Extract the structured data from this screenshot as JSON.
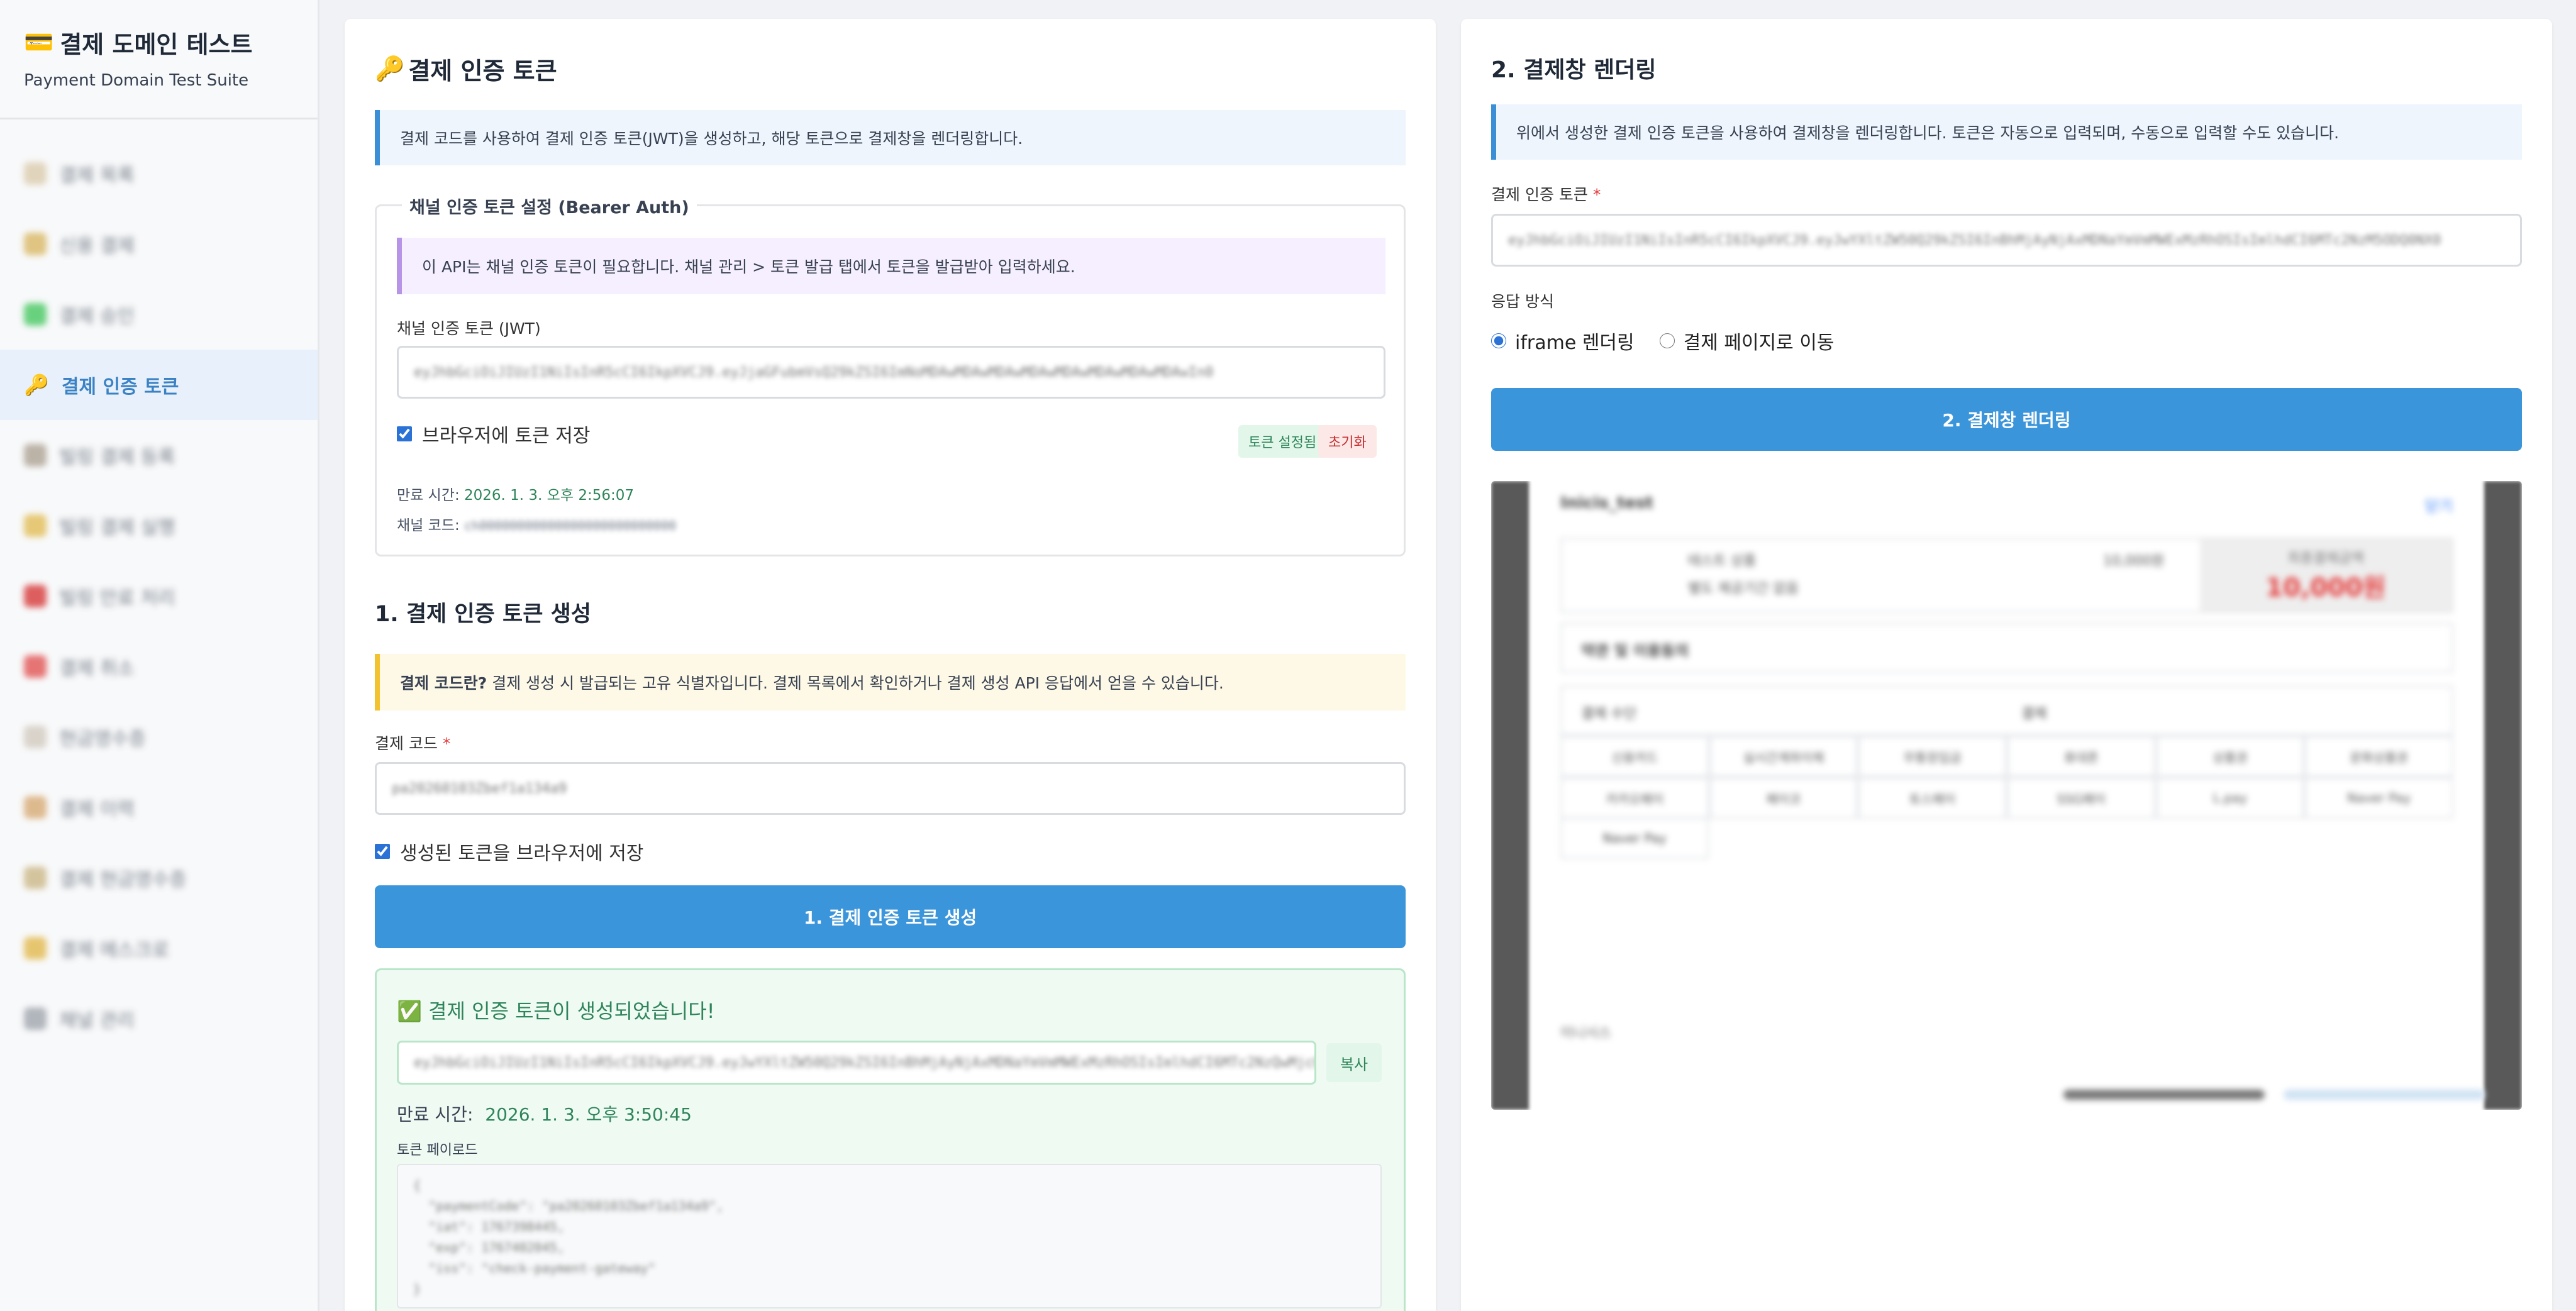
{
  "brand": {
    "icon": "💳",
    "title": "결제 도메인 테스트",
    "subtitle": "Payment Domain Test Suite"
  },
  "nav": [
    {
      "label": "결제 목록",
      "icon": "clipboard-icon",
      "color": "#d9c8a8",
      "active": false
    },
    {
      "label": "신용 결제",
      "icon": "card-icon",
      "color": "#d7b35a",
      "active": false
    },
    {
      "label": "결제 승인",
      "icon": "check-icon",
      "color": "#39c455",
      "active": false
    },
    {
      "label": "결제 인증 토큰",
      "icon": "key-icon",
      "glyph": "🔑",
      "color": "#e0a526",
      "active": true
    },
    {
      "label": "빌링 결제 등록",
      "icon": "link-icon",
      "color": "#a89c8c",
      "active": false
    },
    {
      "label": "빌링 결제 실행",
      "icon": "money-bag-icon",
      "color": "#e0b84a",
      "active": false
    },
    {
      "label": "빌링 만료 처리",
      "icon": "stop-icon",
      "color": "#d42b2b",
      "active": false
    },
    {
      "label": "결제 취소",
      "icon": "x-icon",
      "color": "#e04848",
      "active": false
    },
    {
      "label": "현금영수증",
      "icon": "receipt-icon",
      "color": "#cfc7bb",
      "active": false
    },
    {
      "label": "결제 이력",
      "icon": "calendar-icon",
      "color": "#d5a46b",
      "active": false
    },
    {
      "label": "결제 현금영수증",
      "icon": "money-icon",
      "color": "#c8b380",
      "active": false
    },
    {
      "label": "결제 에스크로",
      "icon": "lock-icon",
      "color": "#e1b441",
      "active": false
    },
    {
      "label": "채널 관리",
      "icon": "wrench-icon",
      "color": "#9aa0a8",
      "active": false
    }
  ],
  "left": {
    "title_icon": "🔑",
    "title": "결제 인증 토큰",
    "intro": "결제 코드를 사용하여 결제 인증 토큰(JWT)을 생성하고, 해당 토큰으로 결제창을 렌더링합니다.",
    "channel": {
      "legend": "채널 인증 토큰 설정 (Bearer Auth)",
      "notice": "이 API는 채널 인증 토큰이 필요합니다. 채널 관리 > 토큰 발급 탭에서 토큰을 발급받아 입력하세요.",
      "token_label": "채널 인증 토큰 (JWT)",
      "token_value": "eyJhbGciOiJIUzI1NiIsInR5cCI6IkpXVCJ9.eyJjaGFubmVsQ29kZSI6ImNoMDAwMDAwMDAwMDAwMDAwMDAwMDAwMDAwIn0",
      "save_label": "브라우저에 토큰 저장",
      "save_checked": true,
      "badge_set": "토큰 설정됨",
      "badge_reset": "초기화",
      "expiry_label": "만료 시간:",
      "expiry_value": "2026. 1. 3. 오후 2:56:07",
      "code_label": "채널 코드:",
      "code_value": "ch00000000000000000000000000"
    },
    "generate": {
      "title": "1. 결제 인증 토큰 생성",
      "tip_bold": "결제 코드란?",
      "tip_text": "결제 생성 시 발급되는 고유 식별자입니다. 결제 목록에서 확인하거나 결제 생성 API 응답에서 얻을 수 있습니다.",
      "code_label": "결제 코드",
      "code_value": "pa20260103Zbef1a134a9",
      "save_label": "생성된 토큰을 브라우저에 저장",
      "save_checked": true,
      "button": "1. 결제 인증 토큰 생성"
    },
    "result": {
      "title": "✅ 결제 인증 토큰이 생성되었습니다!",
      "token_value": "eyJhbGciOiJIUzI1NiIsInR5cCI6IkpXVCJ9.eyJwYXltZW50Q29kZSI6InBhMjAyNjAxMDNaYmVmMWExMzRhOSIsImlhdCI6MTc2NzQwMjc0NX0",
      "copy": "복사",
      "expiry_label": "만료 시간:",
      "expiry_value": "2026. 1. 3. 오후 3:50:45",
      "payload_label": "토큰 페이로드",
      "payload_lines": [
        "{",
        "  \"paymentCode\": \"pa20260103Zbef1a134a9\",",
        "  \"iat\": 1767398445,",
        "  \"exp\": 1767402045,",
        "  \"iss\": \"check-payment-gateway\"",
        "}"
      ]
    }
  },
  "right": {
    "title": "2. 결제창 렌더링",
    "intro": "위에서 생성한 결제 인증 토큰을 사용하여 결제창을 렌더링합니다. 토큰은 자동으로 입력되며, 수동으로 입력할 수도 있습니다.",
    "token_label": "결제 인증 토큰",
    "token_value": "eyJhbGciOiJIUzI1NiIsInR5cCI6IkpXVCJ9.eyJwYXltZW50Q29kZSI6InBhMjAyNjAxMDNaYmVmMWExMzRhOSIsImlhdCI6MTc2NzM5ODQ0NX0",
    "mode_label": "응답 방식",
    "mode_iframe": "iframe 렌더링",
    "mode_page": "결제 페이지로 이동",
    "mode_selected": "iframe",
    "button": "2. 결제창 렌더링",
    "preview": {
      "merchant": "Inicis_test",
      "close": "닫기",
      "price": "10,000원",
      "price_label": "최종결제금액",
      "row1": [
        "상품명",
        "테스트 상품",
        "상품금액",
        "10,000원"
      ],
      "row2": [
        "제공기간",
        "별도 제공기간 없음"
      ],
      "section": "약관 및 이용동의",
      "method1": "결제 수단",
      "method2": "결제",
      "pay_methods": [
        "신용카드",
        "실시간계좌이체",
        "무통장입금",
        "휴대폰",
        "상품권",
        "문화상품권"
      ],
      "pay_methods2": [
        "카카오페이",
        "페이코",
        "토스페이",
        "SSG페이",
        "L.pay",
        "Naver Pay"
      ],
      "footer": "이니시스"
    }
  },
  "colors": {
    "accent": "#3b95da",
    "active_nav_bg": "#e8f1fb",
    "success_bg": "#effaf3",
    "success_text": "#2f855a"
  }
}
